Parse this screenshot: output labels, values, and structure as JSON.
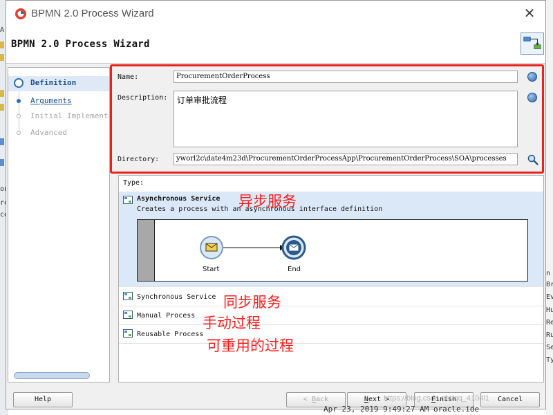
{
  "window": {
    "title": "BPMN 2.0 Process Wizard",
    "close_glyph": "✕"
  },
  "header": {
    "title": "BPMN 2.0 Process Wizard"
  },
  "nav": {
    "items": [
      {
        "label": "Definition",
        "state": "active"
      },
      {
        "label": "Arguments",
        "state": "link"
      },
      {
        "label": "Initial Implementation",
        "state": "disabled"
      },
      {
        "label": "Advanced",
        "state": "disabled"
      }
    ]
  },
  "form": {
    "name_label": "Name:",
    "name_value": "ProcurementOrderProcess",
    "description_label": "Description:",
    "description_value": "订单审批流程",
    "directory_label": "Directory:",
    "directory_value": "yworl2c\\date4m23d\\ProcurementOrderProcessApp\\ProcurementOrderProcess\\SOA\\processes"
  },
  "types": {
    "label": "Type:",
    "options": [
      {
        "title": "Asynchronous Service",
        "description": "Creates a process with an asynchronous interface definition",
        "selected": true
      },
      {
        "title": "Synchronous Service",
        "selected": false
      },
      {
        "title": "Manual Process",
        "selected": false
      },
      {
        "title": "Reusable Process",
        "selected": false
      }
    ],
    "preview": {
      "start_label": "Start",
      "end_label": "End"
    }
  },
  "annotations": {
    "async": "异步服务",
    "sync": "同步服务",
    "manual": "手动过程",
    "reusable": "可重用的过程"
  },
  "buttons": {
    "help": "Help",
    "back_prefix": "< ",
    "back_key": "B",
    "back_rest": "ack",
    "next_key": "N",
    "next_rest": "ext >",
    "finish_key": "F",
    "finish_rest": "inish",
    "cancel": "Cancel"
  },
  "watermark": "https://blog.csdn.net/qq_4104l1",
  "background": {
    "log_line": "Apr 23, 2019 9:49:27 AM oracle.ide",
    "right_fragments": [
      "n",
      "Br",
      "Ev",
      "Hu",
      "Re",
      "Ru",
      "Se",
      "Ty"
    ],
    "left_fragments": [
      "A",
      "on",
      "ro",
      "ce"
    ]
  },
  "colors": {
    "accent": "#2f6db5",
    "highlight_box": "#e8231e",
    "annotation": "#ff1d1d",
    "selected_row": "#dbe8f7"
  },
  "icons": {
    "app": "bpmn-app-icon",
    "header": "process-diagram-icon",
    "field_translate": "globe-icon",
    "directory_browse": "search-icon",
    "type": "process-type-icon"
  }
}
